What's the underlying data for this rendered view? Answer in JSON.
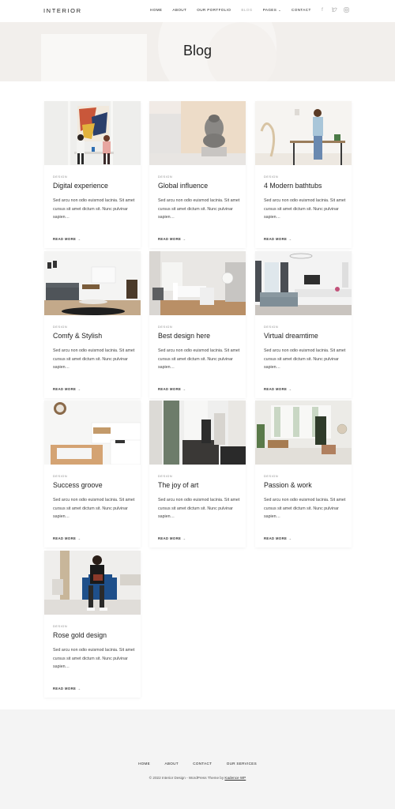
{
  "header": {
    "logo": "INTERIOR",
    "nav": [
      {
        "label": "HOME"
      },
      {
        "label": "ABOUT"
      },
      {
        "label": "OUR PORTFOLIO"
      },
      {
        "label": "BLOG"
      },
      {
        "label": "PAGES"
      },
      {
        "label": "CONTACT"
      }
    ],
    "social_icons": [
      "facebook-icon",
      "twitter-icon",
      "instagram-icon"
    ]
  },
  "hero": {
    "title": "Blog"
  },
  "posts": [
    {
      "category": "DESIGN",
      "title": "Digital experience",
      "excerpt": "Sed arcu non odio euismod lacinia. Sit amet cursus sit amet dictum sit. Nunc pulvinar sapien…",
      "more": "READ MORE →"
    },
    {
      "category": "DESIGN",
      "title": "Global influence",
      "excerpt": "Sed arcu non odio euismod lacinia. Sit amet cursus sit amet dictum sit. Nunc pulvinar sapien…",
      "more": "READ MORE →"
    },
    {
      "category": "DESIGN",
      "title": "4 Modern bathtubs",
      "excerpt": "Sed arcu non odio euismod lacinia. Sit amet cursus sit amet dictum sit. Nunc pulvinar sapien…",
      "more": "READ MORE →"
    },
    {
      "category": "DESIGN",
      "title": "Comfy & Stylish",
      "excerpt": "Sed arcu non odio euismod lacinia. Sit amet cursus sit amet dictum sit. Nunc pulvinar sapien…",
      "more": "READ MORE →"
    },
    {
      "category": "DESIGN",
      "title": "Best design here",
      "excerpt": "Sed arcu non odio euismod lacinia. Sit amet cursus sit amet dictum sit. Nunc pulvinar sapien…",
      "more": "READ MORE →"
    },
    {
      "category": "DESIGN",
      "title": "Virtual dreamtime",
      "excerpt": "Sed arcu non odio euismod lacinia. Sit amet cursus sit amet dictum sit. Nunc pulvinar sapien…",
      "more": "READ MORE →"
    },
    {
      "category": "DESIGN",
      "title": "Success groove",
      "excerpt": "Sed arcu non odio euismod lacinia. Sit amet cursus sit amet dictum sit. Nunc pulvinar sapien…",
      "more": "READ MORE →"
    },
    {
      "category": "DESIGN",
      "title": "The joy of art",
      "excerpt": "Sed arcu non odio euismod lacinia. Sit amet cursus sit amet dictum sit. Nunc pulvinar sapien…",
      "more": "READ MORE →"
    },
    {
      "category": "DESIGN",
      "title": "Passion & work",
      "excerpt": "Sed arcu non odio euismod lacinia. Sit amet cursus sit amet dictum sit. Nunc pulvinar sapien…",
      "more": "READ MORE →"
    },
    {
      "category": "DESIGN",
      "title": "Rose gold design",
      "excerpt": "Sed arcu non odio euismod lacinia. Sit amet cursus sit amet dictum sit. Nunc pulvinar sapien…",
      "more": "READ MORE →"
    }
  ],
  "footer": {
    "nav": [
      {
        "label": "HOME"
      },
      {
        "label": "ABOUT"
      },
      {
        "label": "CONTACT"
      },
      {
        "label": "OUR SERVICES"
      }
    ],
    "copyright": "© 2022 Interior Design - WordPress Theme by ",
    "copyright_link": "Kadence WP"
  }
}
